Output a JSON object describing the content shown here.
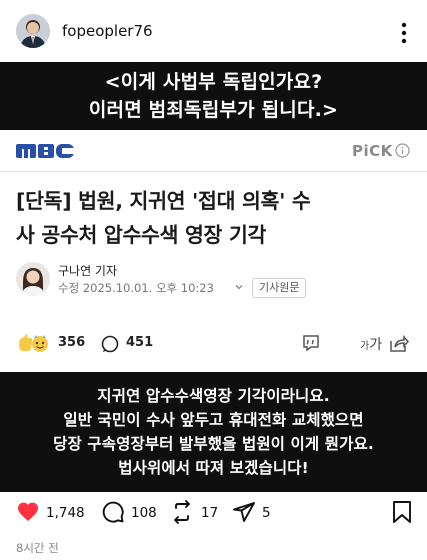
{
  "header": {
    "username": "fopeopler76"
  },
  "post": {
    "caption_top": {
      "line1": "<이게 사법부 독립인가요?",
      "line2": "이러면 범죄독립부가 됩니다.>"
    },
    "news": {
      "brand": "MBC",
      "pick_label": "PiCK",
      "headline_line1": "[단독] 법원, 지귀연 '접대 의혹' 수",
      "headline_line2": "사 공수처 압수수색 영장 기각",
      "reporter": "구나연 기자",
      "edit_time": "수정 2025.10.01. 오후 10:23",
      "source_button": "기사원문",
      "reaction_count": "356",
      "comment_count": "451",
      "fontsize_label": "가",
      "fontsize_small": "가"
    },
    "caption_bottom": {
      "line1": "지귀연 압수수색영장 기각이라니요.",
      "line2": "일반 국민이 수사 앞두고 휴대전화 교체했으면",
      "line3": "당장 구속영장부터 발부했을 법원이 이게 뭔가요.",
      "line4": "법사위에서 따져 보겠습니다!"
    }
  },
  "actions": {
    "likes": "1,748",
    "comments": "108",
    "reposts": "17",
    "shares": "5"
  },
  "timestamp": "8시간 전",
  "colors": {
    "caption_bg": "#0f0f0f",
    "like_red": "#ff3040",
    "mbc_blue": "#2a4fa8"
  }
}
